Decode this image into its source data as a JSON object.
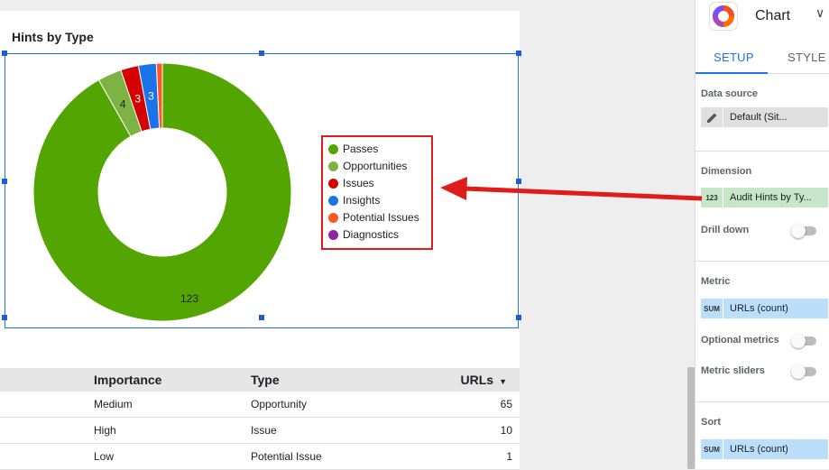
{
  "card": {
    "title": "Hints by Type"
  },
  "chart_data": {
    "type": "pie",
    "donut": true,
    "categories": [
      "Passes",
      "Opportunities",
      "Issues",
      "Insights",
      "Potential Issues",
      "Diagnostics"
    ],
    "values": [
      123,
      4,
      3,
      3,
      1,
      0
    ],
    "colors": [
      "#53a601",
      "#7cb342",
      "#d50000",
      "#1a73e8",
      "#ff5722",
      "#8e24aa"
    ],
    "labels": [
      "123",
      "4",
      "3",
      "3",
      "",
      ""
    ],
    "title": "Hints by Type",
    "legend_position": "right"
  },
  "table": {
    "headers": [
      "Importance",
      "Type",
      "URLs"
    ],
    "sort_indicator": "▼",
    "rows": [
      [
        "Medium",
        "Opportunity",
        "65"
      ],
      [
        "High",
        "Issue",
        "10"
      ],
      [
        "Low",
        "Potential Issue",
        "1"
      ]
    ]
  },
  "panel": {
    "chart_name": "Chart",
    "chevron": "∨",
    "tabs": [
      "SETUP",
      "STYLE"
    ],
    "data_source_label": "Data source",
    "data_source_value": "Default (Sit...",
    "dimension_label": "Dimension",
    "dimension_badge": "123",
    "dimension_value": "Audit Hints by Ty...",
    "drill_down_label": "Drill down",
    "metric_label": "Metric",
    "metric_badge": "SUM",
    "metric_value": "URLs (count)",
    "optional_metrics_label": "Optional metrics",
    "metric_sliders_label": "Metric sliders",
    "sort_label": "Sort",
    "sort_badge": "SUM",
    "sort_value": "URLs (count)"
  },
  "annotation": {
    "arrow_color": "#e01b1b"
  }
}
